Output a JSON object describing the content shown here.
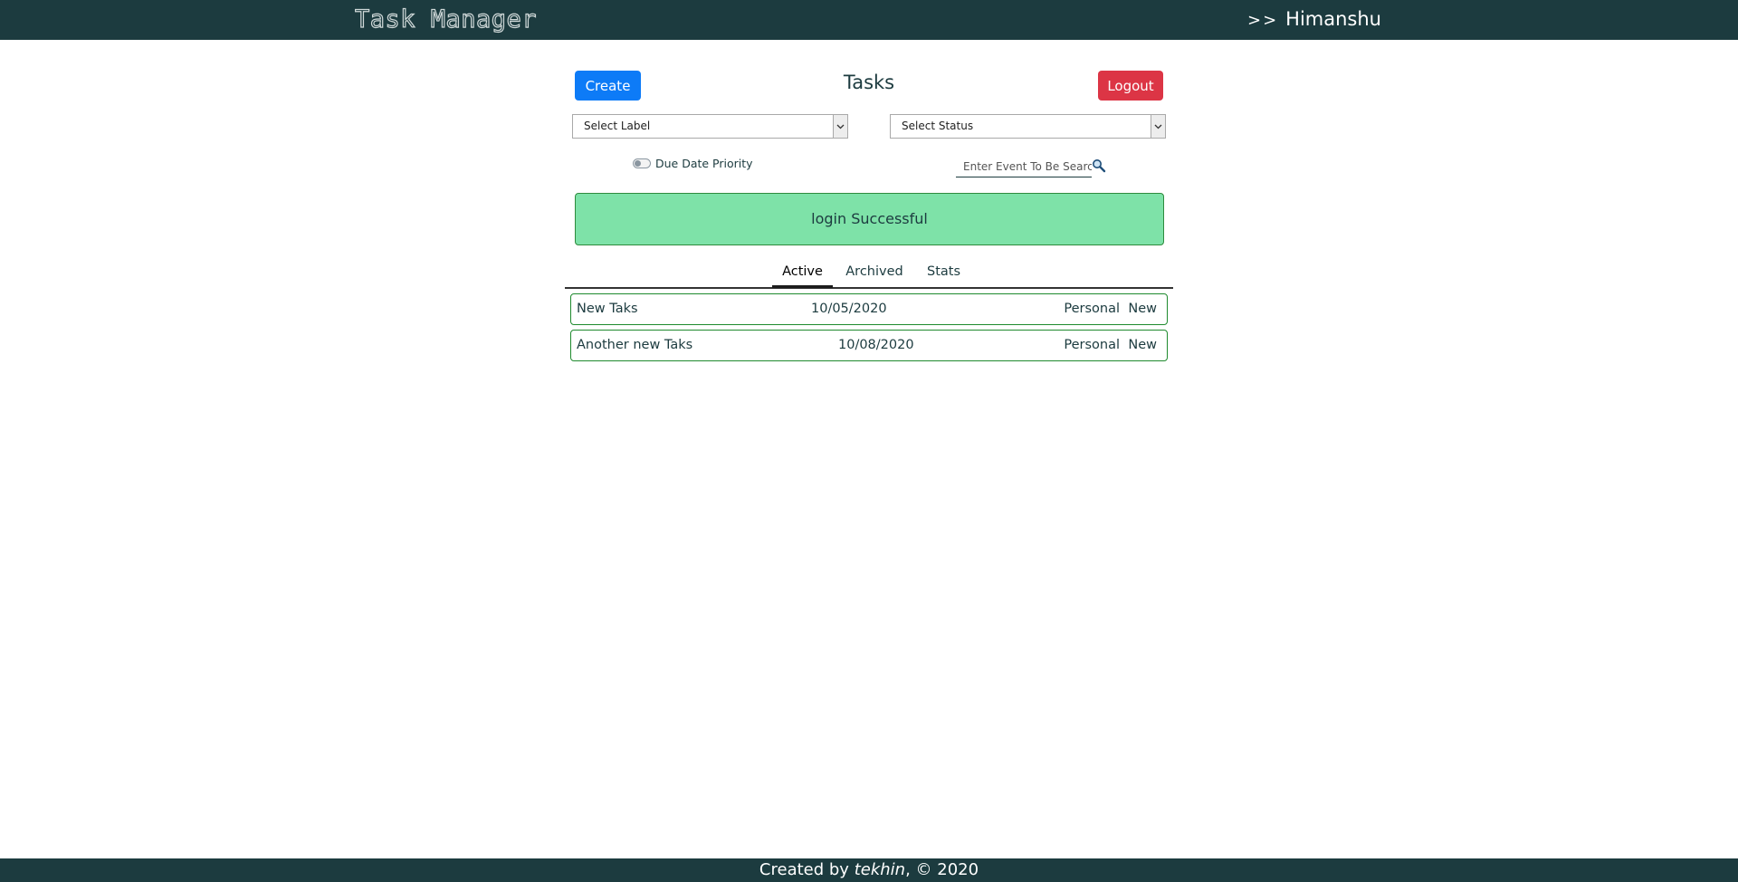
{
  "header": {
    "brand": "Task Manager",
    "user_prefix": ">>",
    "user_name": "Himanshu"
  },
  "toolbar": {
    "create_label": "Create",
    "title": "Tasks",
    "logout_label": "Logout"
  },
  "filters": {
    "label_select": "Select Label",
    "status_select": "Select Status",
    "toggle_label": "Due Date Priority",
    "toggle_on": false,
    "search_placeholder": "Enter Event To Be Searched"
  },
  "alert": {
    "message": "login Successful",
    "color": "#7ee2a8"
  },
  "tabs": [
    {
      "label": "Active",
      "active": true
    },
    {
      "label": "Archived",
      "active": false
    },
    {
      "label": "Stats",
      "active": false
    }
  ],
  "tasks": [
    {
      "title": "New Taks",
      "date": "10/05/2020",
      "label": "Personal",
      "status": "New"
    },
    {
      "title": "Another new Taks",
      "date": "10/08/2020",
      "label": "Personal",
      "status": "New"
    }
  ],
  "footer": {
    "prefix": "Created by",
    "author": "tekhin",
    "suffix": ", © 2020"
  },
  "colors": {
    "nav": "#1c3b3f",
    "create": "#0d7bf7",
    "logout": "#dc3545",
    "task_border": "#1f8a2e"
  },
  "icons": {
    "search": "magnifier-icon",
    "select_arrow": "chevron-down-icon"
  }
}
